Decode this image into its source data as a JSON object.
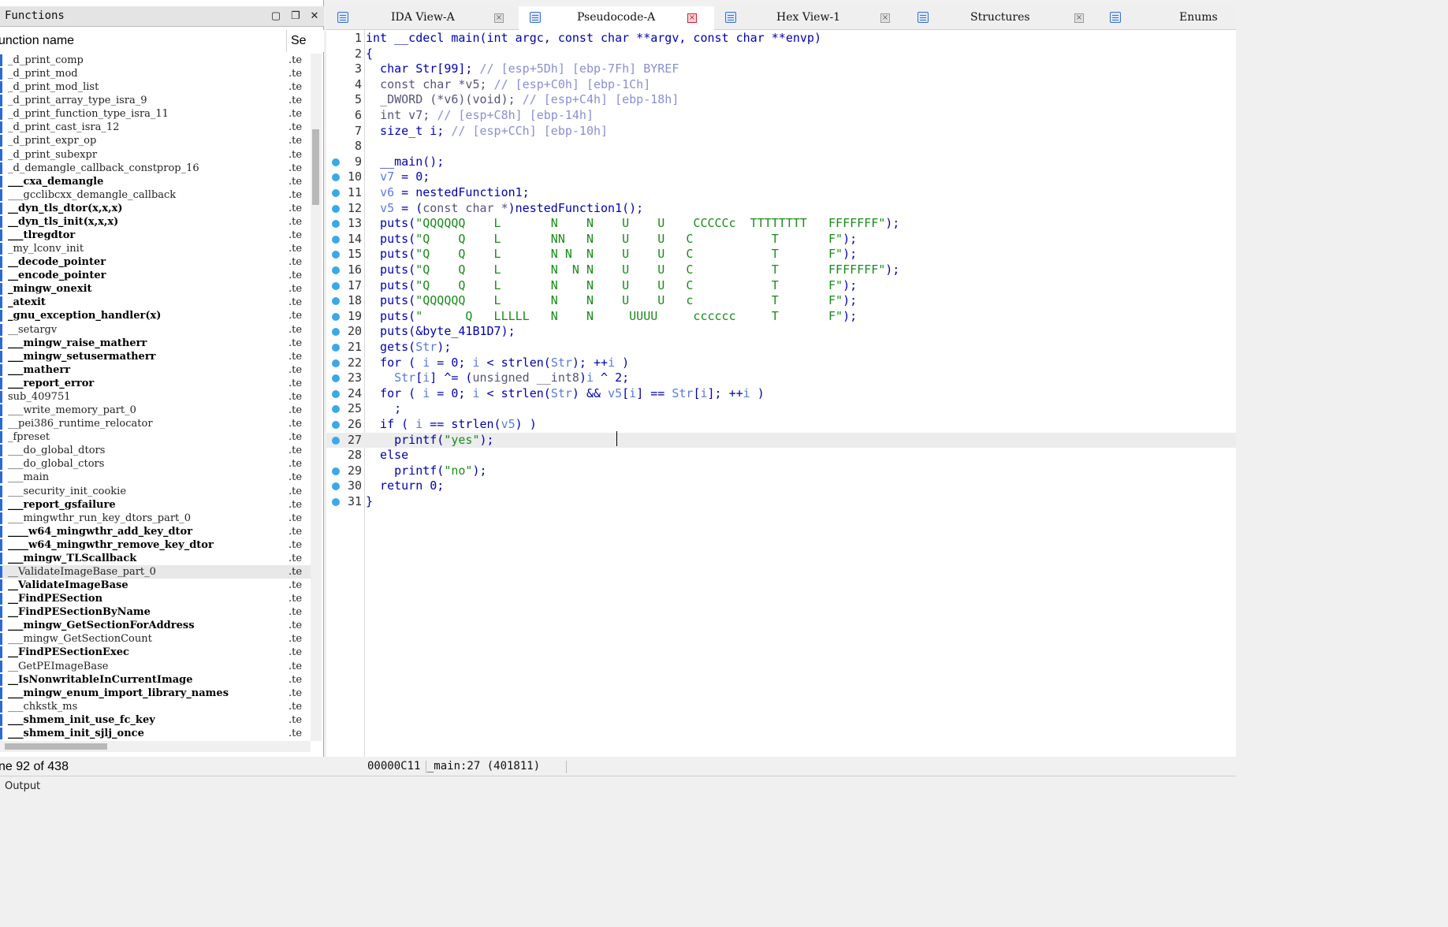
{
  "functions_panel": {
    "title": "Functions",
    "column_name": "unction name",
    "column_segment": "Se",
    "status": "ne 92 of 438",
    "items": [
      {
        "name": "_d_print_comp",
        "seg": ".te",
        "bold": false
      },
      {
        "name": "_d_print_mod",
        "seg": ".te",
        "bold": false
      },
      {
        "name": "_d_print_mod_list",
        "seg": ".te",
        "bold": false
      },
      {
        "name": "_d_print_array_type_isra_9",
        "seg": ".te",
        "bold": false
      },
      {
        "name": "_d_print_function_type_isra_11",
        "seg": ".te",
        "bold": false
      },
      {
        "name": "_d_print_cast_isra_12",
        "seg": ".te",
        "bold": false
      },
      {
        "name": "_d_print_expr_op",
        "seg": ".te",
        "bold": false
      },
      {
        "name": "_d_print_subexpr",
        "seg": ".te",
        "bold": false
      },
      {
        "name": "_d_demangle_callback_constprop_16",
        "seg": ".te",
        "bold": false
      },
      {
        "name": "___cxa_demangle",
        "seg": ".te",
        "bold": true
      },
      {
        "name": "___gcclibcxx_demangle_callback",
        "seg": ".te",
        "bold": false
      },
      {
        "name": "__dyn_tls_dtor(x,x,x)",
        "seg": ".te",
        "bold": true
      },
      {
        "name": "__dyn_tls_init(x,x,x)",
        "seg": ".te",
        "bold": true
      },
      {
        "name": "___tlregdtor",
        "seg": ".te",
        "bold": true
      },
      {
        "name": "_my_lconv_init",
        "seg": ".te",
        "bold": false
      },
      {
        "name": "__decode_pointer",
        "seg": ".te",
        "bold": true
      },
      {
        "name": "__encode_pointer",
        "seg": ".te",
        "bold": true
      },
      {
        "name": "_mingw_onexit",
        "seg": ".te",
        "bold": true
      },
      {
        "name": "_atexit",
        "seg": ".te",
        "bold": true
      },
      {
        "name": "_gnu_exception_handler(x)",
        "seg": ".te",
        "bold": true
      },
      {
        "name": "__setargv",
        "seg": ".te",
        "bold": false
      },
      {
        "name": "___mingw_raise_matherr",
        "seg": ".te",
        "bold": true
      },
      {
        "name": "___mingw_setusermatherr",
        "seg": ".te",
        "bold": true
      },
      {
        "name": "___matherr",
        "seg": ".te",
        "bold": true
      },
      {
        "name": "___report_error",
        "seg": ".te",
        "bold": true
      },
      {
        "name": "sub_409751",
        "seg": ".te",
        "bold": false
      },
      {
        "name": "___write_memory_part_0",
        "seg": ".te",
        "bold": false
      },
      {
        "name": "__pei386_runtime_relocator",
        "seg": ".te",
        "bold": false
      },
      {
        "name": "_fpreset",
        "seg": ".te",
        "bold": false
      },
      {
        "name": "___do_global_dtors",
        "seg": ".te",
        "bold": false
      },
      {
        "name": "___do_global_ctors",
        "seg": ".te",
        "bold": false
      },
      {
        "name": "___main",
        "seg": ".te",
        "bold": false
      },
      {
        "name": "___security_init_cookie",
        "seg": ".te",
        "bold": false
      },
      {
        "name": "___report_gsfailure",
        "seg": ".te",
        "bold": true
      },
      {
        "name": "___mingwthr_run_key_dtors_part_0",
        "seg": ".te",
        "bold": false
      },
      {
        "name": "____w64_mingwthr_add_key_dtor",
        "seg": ".te",
        "bold": true
      },
      {
        "name": "____w64_mingwthr_remove_key_dtor",
        "seg": ".te",
        "bold": true
      },
      {
        "name": "___mingw_TLScallback",
        "seg": ".te",
        "bold": true
      },
      {
        "name": "__ValidateImageBase_part_0",
        "seg": ".te",
        "bold": false
      },
      {
        "name": "__ValidateImageBase",
        "seg": ".te",
        "bold": true
      },
      {
        "name": "__FindPESection",
        "seg": ".te",
        "bold": true
      },
      {
        "name": "__FindPESectionByName",
        "seg": ".te",
        "bold": true
      },
      {
        "name": "___mingw_GetSectionForAddress",
        "seg": ".te",
        "bold": true
      },
      {
        "name": "___mingw_GetSectionCount",
        "seg": ".te",
        "bold": false
      },
      {
        "name": "__FindPESectionExec",
        "seg": ".te",
        "bold": true
      },
      {
        "name": "__GetPEImageBase",
        "seg": ".te",
        "bold": false
      },
      {
        "name": "__IsNonwritableInCurrentImage",
        "seg": ".te",
        "bold": true
      },
      {
        "name": "___mingw_enum_import_library_names",
        "seg": ".te",
        "bold": true
      },
      {
        "name": "___chkstk_ms",
        "seg": ".te",
        "bold": false
      },
      {
        "name": "___shmem_init_use_fc_key",
        "seg": ".te",
        "bold": true
      },
      {
        "name": "___shmem_init_sjlj_once",
        "seg": ".te",
        "bold": true
      }
    ]
  },
  "tabs": [
    {
      "label": "IDA View-A",
      "active": false
    },
    {
      "label": "Pseudocode-A",
      "active": true
    },
    {
      "label": "Hex View-1",
      "active": false
    },
    {
      "label": "Structures",
      "active": false
    },
    {
      "label": "Enums",
      "active": false
    }
  ],
  "code": {
    "lines": [
      {
        "n": "1",
        "dot": false,
        "html": "int __cdecl main(int argc, const char **argv, const char **envp)"
      },
      {
        "n": "2",
        "dot": false,
        "html": "{"
      },
      {
        "n": "3",
        "dot": false,
        "html": "  char Str[99]; <span class=\"c\">// [esp+5Dh] [ebp-7Fh] BYREF</span>"
      },
      {
        "n": "4",
        "dot": false,
        "html": "  <span class=\"m\">const char *v5;</span> <span class=\"c\">// [esp+C0h] [ebp-1Ch]</span>"
      },
      {
        "n": "5",
        "dot": false,
        "html": "  <span class=\"m\">_DWORD (*v6)(void);</span> <span class=\"c\">// [esp+C4h] [ebp-18h]</span>"
      },
      {
        "n": "6",
        "dot": false,
        "html": "  <span class=\"m\">int v7;</span> <span class=\"c\">// [esp+C8h] [ebp-14h]</span>"
      },
      {
        "n": "7",
        "dot": false,
        "html": "  size_t i; <span class=\"c\">// [esp+CCh] [ebp-10h]</span>"
      },
      {
        "n": "8",
        "dot": false,
        "html": ""
      },
      {
        "n": "9",
        "dot": true,
        "html": "  __main();"
      },
      {
        "n": "10",
        "dot": true,
        "html": "  <span class=\"v\">v7</span> = 0;"
      },
      {
        "n": "11",
        "dot": true,
        "html": "  <span class=\"v\">v6</span> = nestedFunction1;"
      },
      {
        "n": "12",
        "dot": true,
        "html": "  <span class=\"v\">v5</span> = (<span class=\"m\">const char *</span>)nestedFunction1();"
      },
      {
        "n": "13",
        "dot": true,
        "html": "  puts(<span class=\"g\">\"QQQQQQ    L       N    N    U    U    CCCCCc  TTTTTTTT   FFFFFFF\"</span>);"
      },
      {
        "n": "14",
        "dot": true,
        "html": "  puts(<span class=\"g\">\"Q    Q    L       NN   N    U    U   C           T       F\"</span>);"
      },
      {
        "n": "15",
        "dot": true,
        "html": "  puts(<span class=\"g\">\"Q    Q    L       N N  N    U    U   C           T       F\"</span>);"
      },
      {
        "n": "16",
        "dot": true,
        "html": "  puts(<span class=\"g\">\"Q    Q    L       N  N N    U    U   C           T       FFFFFFF\"</span>);"
      },
      {
        "n": "17",
        "dot": true,
        "html": "  puts(<span class=\"g\">\"Q    Q    L       N    N    U    U   C           T       F\"</span>);"
      },
      {
        "n": "18",
        "dot": true,
        "html": "  puts(<span class=\"g\">\"QQQQQQ    L       N    N    U    U   c           T       F\"</span>);"
      },
      {
        "n": "19",
        "dot": true,
        "html": "  puts(<span class=\"g\">\"      Q   LLLLL   N    N     UUUU     cccccc     T       F\"</span>);"
      },
      {
        "n": "20",
        "dot": true,
        "html": "  puts(&amp;byte_41B1D7);"
      },
      {
        "n": "21",
        "dot": true,
        "html": "  gets(<span class=\"v\">Str</span>);"
      },
      {
        "n": "22",
        "dot": true,
        "html": "  for ( <span class=\"v\">i</span> = 0; <span class=\"v\">i</span> &lt; strlen(<span class=\"v\">Str</span>); ++<span class=\"v\">i</span> )"
      },
      {
        "n": "23",
        "dot": true,
        "html": "    <span class=\"v\">Str</span>[<span class=\"v\">i</span>] ^= (<span class=\"m\">unsigned __int8</span>)<span class=\"v\">i</span> ^ 2;"
      },
      {
        "n": "24",
        "dot": true,
        "html": "  for ( <span class=\"v\">i</span> = 0; <span class=\"v\">i</span> &lt; strlen(<span class=\"v\">Str</span>) &amp;&amp; <span class=\"v\">v5</span>[<span class=\"v\">i</span>] == <span class=\"v\">Str</span>[<span class=\"v\">i</span>]; ++<span class=\"v\">i</span> )"
      },
      {
        "n": "25",
        "dot": true,
        "html": "    ;"
      },
      {
        "n": "26",
        "dot": true,
        "html": "  if ( <span class=\"v\">i</span> == strlen(<span class=\"v\">v5</span>) )"
      },
      {
        "n": "27",
        "dot": true,
        "html": "    printf(<span class=\"g\">\"yes\"</span>);"
      },
      {
        "n": "28",
        "dot": false,
        "html": "  else"
      },
      {
        "n": "29",
        "dot": true,
        "html": "    printf(<span class=\"g\">\"no\"</span>);"
      },
      {
        "n": "30",
        "dot": true,
        "html": "  return 0;"
      },
      {
        "n": "31",
        "dot": true,
        "html": "}"
      }
    ],
    "current_line": "27",
    "status": "00000C11 _main:27 (401811)"
  },
  "output_label": "Output"
}
